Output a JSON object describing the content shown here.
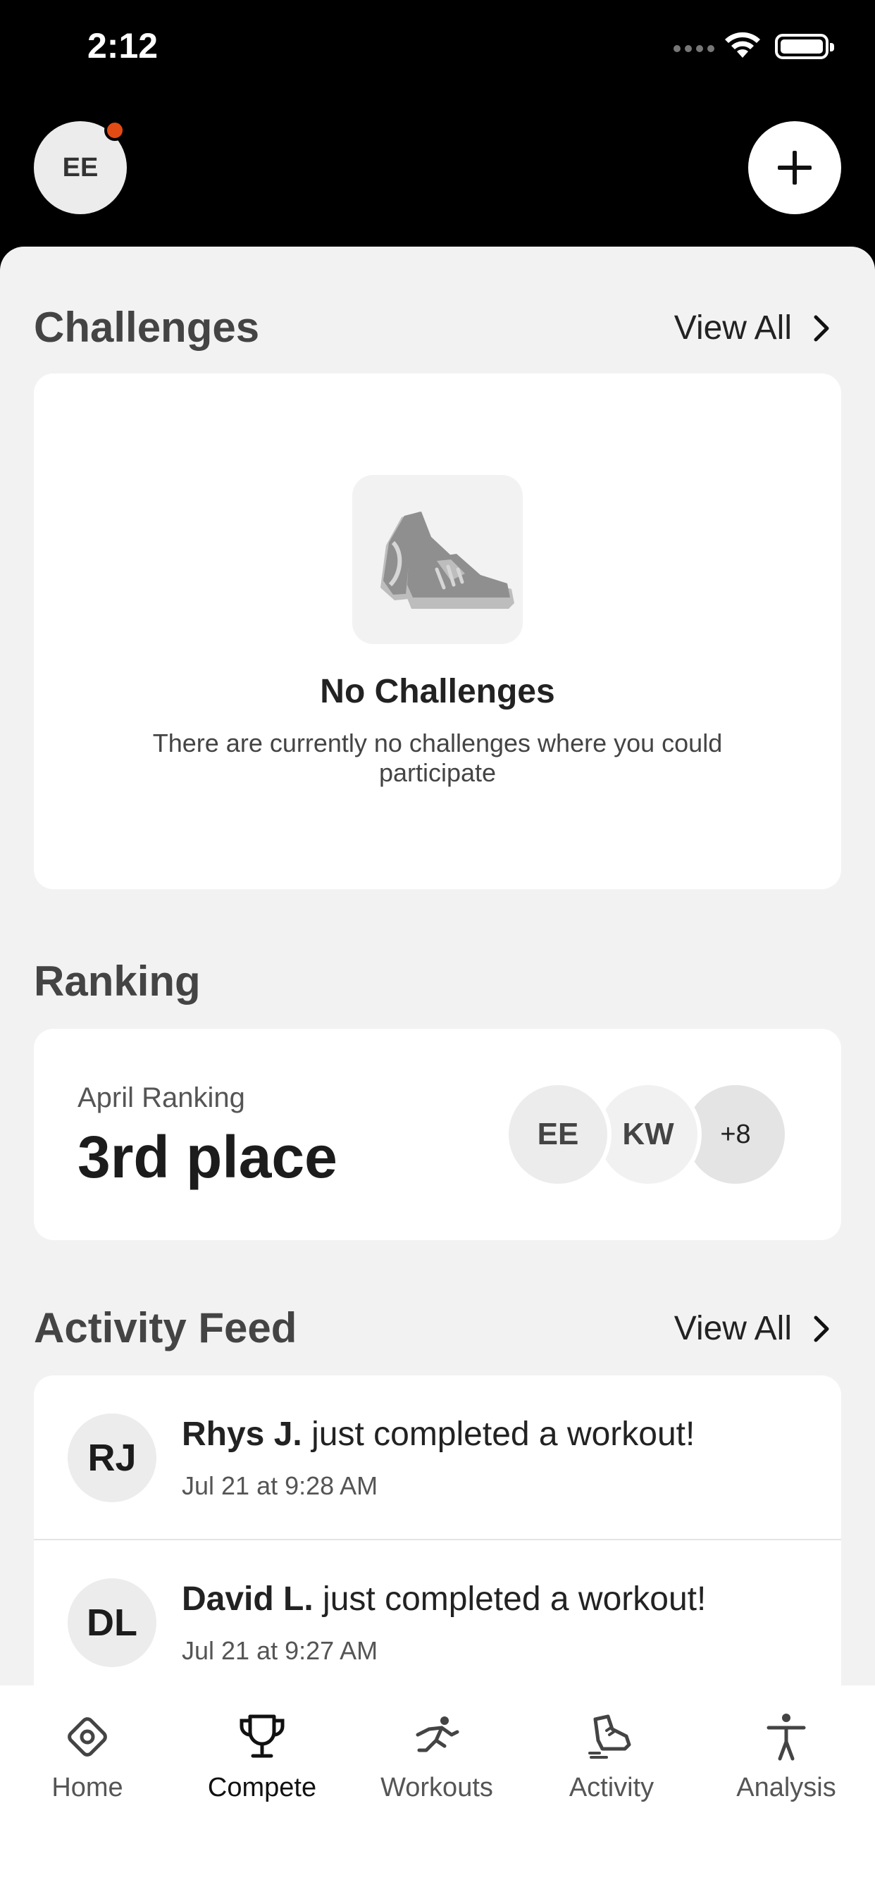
{
  "status_bar": {
    "time": "2:12"
  },
  "header": {
    "avatar_initials": "EE"
  },
  "challenges": {
    "title": "Challenges",
    "view_all": "View All",
    "empty_title": "No Challenges",
    "empty_description": "There are currently no challenges where you could participate"
  },
  "ranking": {
    "title": "Ranking",
    "label": "April Ranking",
    "value": "3rd place",
    "avatars": [
      "EE",
      "KW",
      "+8"
    ]
  },
  "activity_feed": {
    "title": "Activity Feed",
    "view_all": "View All",
    "items": [
      {
        "initials": "RJ",
        "name": "Rhys J.",
        "message": " just completed a workout!",
        "time": "Jul 21 at 9:28 AM"
      },
      {
        "initials": "DL",
        "name": "David L.",
        "message": " just completed a workout!",
        "time": "Jul 21 at 9:27 AM"
      }
    ]
  },
  "tabs": [
    {
      "label": "Home",
      "icon": "home-diamond-icon"
    },
    {
      "label": "Compete",
      "icon": "trophy-icon",
      "active": true
    },
    {
      "label": "Workouts",
      "icon": "running-figure-icon"
    },
    {
      "label": "Activity",
      "icon": "shoe-activity-icon"
    },
    {
      "label": "Analysis",
      "icon": "person-figure-icon"
    }
  ],
  "colors": {
    "notification": "#e34b15",
    "background": "#f2f2f2"
  }
}
